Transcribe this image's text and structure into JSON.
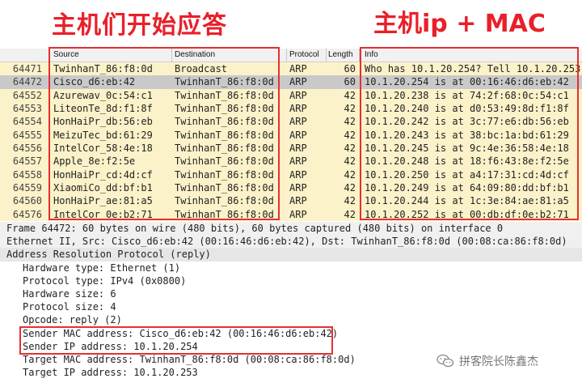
{
  "annotations": {
    "left": "主机们开始应答",
    "right": "主机ip + MAC"
  },
  "packet_list": {
    "columns": [
      "Source",
      "Destination",
      "Protocol",
      "Length",
      "Info"
    ],
    "rows": [
      {
        "no": "64471",
        "source": "TwinhanT_86:f8:0d",
        "destination": "Broadcast",
        "protocol": "ARP",
        "length": "60",
        "info": "Who has 10.1.20.254? Tell 10.1.20.253",
        "selected": false
      },
      {
        "no": "64472",
        "source": "Cisco_d6:eb:42",
        "destination": "TwinhanT_86:f8:0d",
        "protocol": "ARP",
        "length": "60",
        "info": "10.1.20.254 is at 00:16:46:d6:eb:42",
        "selected": true
      },
      {
        "no": "64552",
        "source": "Azurewav_0c:54:c1",
        "destination": "TwinhanT_86:f8:0d",
        "protocol": "ARP",
        "length": "42",
        "info": "10.1.20.238 is at 74:2f:68:0c:54:c1",
        "selected": false
      },
      {
        "no": "64553",
        "source": "LiteonTe_8d:f1:8f",
        "destination": "TwinhanT_86:f8:0d",
        "protocol": "ARP",
        "length": "42",
        "info": "10.1.20.240 is at d0:53:49:8d:f1:8f",
        "selected": false
      },
      {
        "no": "64554",
        "source": "HonHaiPr_db:56:eb",
        "destination": "TwinhanT_86:f8:0d",
        "protocol": "ARP",
        "length": "42",
        "info": "10.1.20.242 is at 3c:77:e6:db:56:eb",
        "selected": false
      },
      {
        "no": "64555",
        "source": "MeizuTec_bd:61:29",
        "destination": "TwinhanT_86:f8:0d",
        "protocol": "ARP",
        "length": "42",
        "info": "10.1.20.243 is at 38:bc:1a:bd:61:29",
        "selected": false
      },
      {
        "no": "64556",
        "source": "IntelCor_58:4e:18",
        "destination": "TwinhanT_86:f8:0d",
        "protocol": "ARP",
        "length": "42",
        "info": "10.1.20.245 is at 9c:4e:36:58:4e:18",
        "selected": false
      },
      {
        "no": "64557",
        "source": "Apple_8e:f2:5e",
        "destination": "TwinhanT_86:f8:0d",
        "protocol": "ARP",
        "length": "42",
        "info": "10.1.20.248 is at 18:f6:43:8e:f2:5e",
        "selected": false
      },
      {
        "no": "64558",
        "source": "HonHaiPr_cd:4d:cf",
        "destination": "TwinhanT_86:f8:0d",
        "protocol": "ARP",
        "length": "42",
        "info": "10.1.20.250 is at a4:17:31:cd:4d:cf",
        "selected": false
      },
      {
        "no": "64559",
        "source": "XiaomiCo_dd:bf:b1",
        "destination": "TwinhanT_86:f8:0d",
        "protocol": "ARP",
        "length": "42",
        "info": "10.1.20.249 is at 64:09:80:dd:bf:b1",
        "selected": false
      },
      {
        "no": "64560",
        "source": "HonHaiPr_ae:81:a5",
        "destination": "TwinhanT_86:f8:0d",
        "protocol": "ARP",
        "length": "42",
        "info": "10.1.20.244 is at 1c:3e:84:ae:81:a5",
        "selected": false
      },
      {
        "no": "64576",
        "source": "IntelCor_0e:b2:71",
        "destination": "TwinhanT_86:f8:0d",
        "protocol": "ARP",
        "length": "42",
        "info": "10.1.20.252 is at 00:db:df:0e:b2:71",
        "selected": false
      }
    ]
  },
  "details": {
    "frame": "Frame 64472: 60 bytes on wire (480 bits), 60 bytes captured (480 bits) on interface 0",
    "ethernet": "Ethernet II, Src: Cisco_d6:eb:42 (00:16:46:d6:eb:42), Dst: TwinhanT_86:f8:0d (00:08:ca:86:f8:0d)",
    "arp_title": "Address Resolution Protocol (reply)",
    "fields": [
      "Hardware type: Ethernet (1)",
      "Protocol type: IPv4 (0x0800)",
      "Hardware size: 6",
      "Protocol size: 4",
      "Opcode: reply (2)",
      "Sender MAC address: Cisco_d6:eb:42 (00:16:46:d6:eb:42)",
      "Sender IP address: 10.1.20.254",
      "Target MAC address: TwinhanT_86:f8:0d (00:08:ca:86:f8:0d)",
      "Target IP address: 10.1.20.253"
    ]
  },
  "watermark": "拼客院长陈鑫杰",
  "colors": {
    "row_bg": "#fbf2c9",
    "selected_bg": "#c9c9c9",
    "annotation": "#e8202a"
  }
}
